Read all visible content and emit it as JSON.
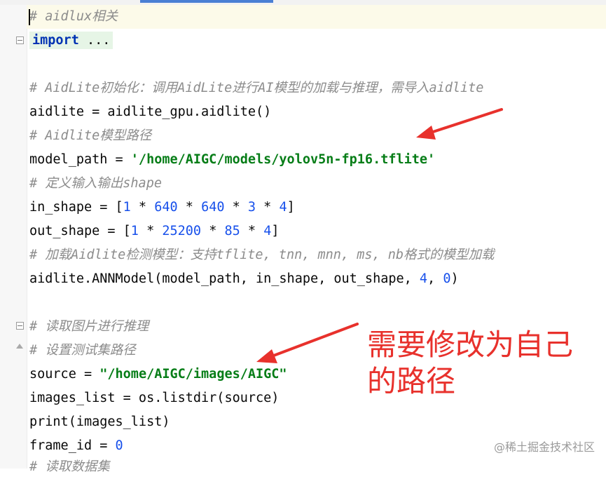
{
  "code": {
    "line1_comment": "# aidlux相关",
    "line2_keyword": "import",
    "line2_fold": " ...",
    "line4_comment": "# AidLite初始化：调用AidLite进行AI模型的加载与推理，需导入aidlite",
    "line5_code": "aidlite = aidlite_gpu.aidlite()",
    "line6_comment": "# Aidlite模型路径",
    "line7_code": "model_path = ",
    "line7_string": "'/home/AIGC/models/yolov5n-fp16.tflite'",
    "line8_comment": "# 定义输入输出shape",
    "line9": [
      "in_shape = [",
      "1",
      " * ",
      "640",
      " * ",
      "640",
      " * ",
      "3",
      " * ",
      "4",
      "]"
    ],
    "line10": [
      "out_shape = [",
      "1",
      " * ",
      "25200",
      " * ",
      "85",
      " * ",
      "4",
      "]"
    ],
    "line11_comment": "# 加载Aidlite检测模型：支持tflite, tnn, mnn, ms, nb格式的模型加载",
    "line12": [
      "aidlite.ANNModel(model_path, in_shape, out_shape, ",
      "4",
      ", ",
      "0",
      ")"
    ],
    "line14_comment": "# 读取图片进行推理",
    "line15_comment": "# 设置测试集路径",
    "line16_code": "source = ",
    "line16_string": "\"/home/AIGC/images/AIGC\"",
    "line17_code": "images_list = os.listdir(source)",
    "line18_code": "print(images_list)",
    "line19_code": "frame_id = ",
    "line19_number": "0",
    "line20_comment": "# 读取数据集"
  },
  "annotation": {
    "note_line1": "需要修改为自己",
    "note_line2": "的路径",
    "color": "#e8312c"
  },
  "watermark": "@稀土掘金技术社区"
}
